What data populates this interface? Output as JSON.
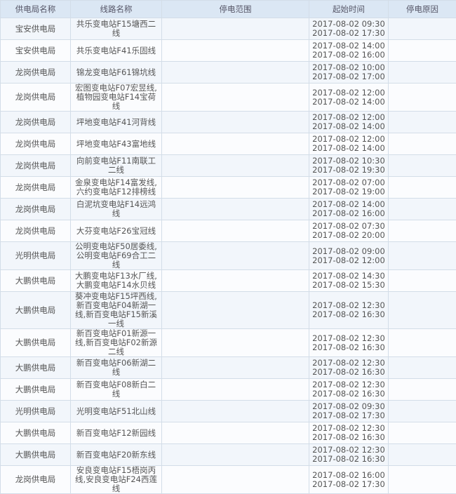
{
  "headers": [
    "供电局名称",
    "线路名称",
    "停电范围",
    "起始时间",
    "停电原因"
  ],
  "rows": [
    {
      "bureau": "宝安供电局",
      "line": "共乐变电站F15塘西二线",
      "range": "",
      "start": "2017-08-02 09:30",
      "end": "2017-08-02 17:30",
      "reason": ""
    },
    {
      "bureau": "宝安供电局",
      "line": "共乐变电站F41乐固线",
      "range": "",
      "start": "2017-08-02 14:00",
      "end": "2017-08-02 16:00",
      "reason": ""
    },
    {
      "bureau": "龙岗供电局",
      "line": "锦龙变电站F61锦坑线",
      "range": "",
      "start": "2017-08-02 10:00",
      "end": "2017-08-02 17:00",
      "reason": ""
    },
    {
      "bureau": "龙岗供电局",
      "line": "宏图变电站F07宏昱线,植物园变电站F14宝荷线",
      "range": "",
      "start": "2017-08-02 12:00",
      "end": "2017-08-02 14:00",
      "reason": ""
    },
    {
      "bureau": "龙岗供电局",
      "line": "坪地变电站F41河背线",
      "range": "",
      "start": "2017-08-02 12:00",
      "end": "2017-08-02 14:00",
      "reason": ""
    },
    {
      "bureau": "龙岗供电局",
      "line": "坪地变电站F43富地线",
      "range": "",
      "start": "2017-08-02 12:00",
      "end": "2017-08-02 14:00",
      "reason": ""
    },
    {
      "bureau": "龙岗供电局",
      "line": "向前变电站F11南联工二线",
      "range": "",
      "start": "2017-08-02 10:30",
      "end": "2017-08-02 19:30",
      "reason": ""
    },
    {
      "bureau": "龙岗供电局",
      "line": "金泉变电站F14富发线,六约变电站F12排榜线",
      "range": "",
      "start": "2017-08-02 07:00",
      "end": "2017-08-02 19:00",
      "reason": ""
    },
    {
      "bureau": "龙岗供电局",
      "line": "白泥坑变电站F14远鸿线",
      "range": "",
      "start": "2017-08-02 14:00",
      "end": "2017-08-02 16:00",
      "reason": ""
    },
    {
      "bureau": "龙岗供电局",
      "line": "大芬变电站F26宝冠线",
      "range": "",
      "start": "2017-08-02 07:30",
      "end": "2017-08-02 20:00",
      "reason": ""
    },
    {
      "bureau": "光明供电局",
      "line": "公明变电站F50居委线,公明变电站F69合工二线",
      "range": "",
      "start": "2017-08-02 09:00",
      "end": "2017-08-02 12:00",
      "reason": ""
    },
    {
      "bureau": "大鹏供电局",
      "line": "大鹏变电站F13水厂线,大鹏变电站F14水贝线",
      "range": "",
      "start": "2017-08-02 14:30",
      "end": "2017-08-02 15:30",
      "reason": ""
    },
    {
      "bureau": "大鹏供电局",
      "line": "葵冲变电站F15坪西线,新百变电站F04新湖一线,新百变电站F15新溪一线",
      "range": "",
      "start": "2017-08-02 12:30",
      "end": "2017-08-02 16:30",
      "reason": "",
      "tall": true
    },
    {
      "bureau": "大鹏供电局",
      "line": "新百变电站F01新源一线,新百变电站F02新源二线",
      "range": "",
      "start": "2017-08-02 12:30",
      "end": "2017-08-02 16:30",
      "reason": ""
    },
    {
      "bureau": "大鹏供电局",
      "line": "新百变电站F06新湖二线",
      "range": "",
      "start": "2017-08-02 12:30",
      "end": "2017-08-02 16:30",
      "reason": ""
    },
    {
      "bureau": "大鹏供电局",
      "line": "新百变电站F08新白二线",
      "range": "",
      "start": "2017-08-02 12:30",
      "end": "2017-08-02 16:30",
      "reason": ""
    },
    {
      "bureau": "光明供电局",
      "line": "光明变电站F51北山线",
      "range": "",
      "start": "2017-08-02 09:30",
      "end": "2017-08-02 17:30",
      "reason": ""
    },
    {
      "bureau": "大鹏供电局",
      "line": "新百变电站F12新园线",
      "range": "",
      "start": "2017-08-02 12:30",
      "end": "2017-08-02 16:30",
      "reason": ""
    },
    {
      "bureau": "大鹏供电局",
      "line": "新百变电站F20新东线",
      "range": "",
      "start": "2017-08-02 12:30",
      "end": "2017-08-02 16:30",
      "reason": ""
    },
    {
      "bureau": "龙岗供电局",
      "line": "安良变电站F15梧岗丙线,安良变电站F24西莲线",
      "range": "",
      "start": "2017-08-02 16:00",
      "end": "2017-08-02 17:30",
      "reason": ""
    }
  ]
}
